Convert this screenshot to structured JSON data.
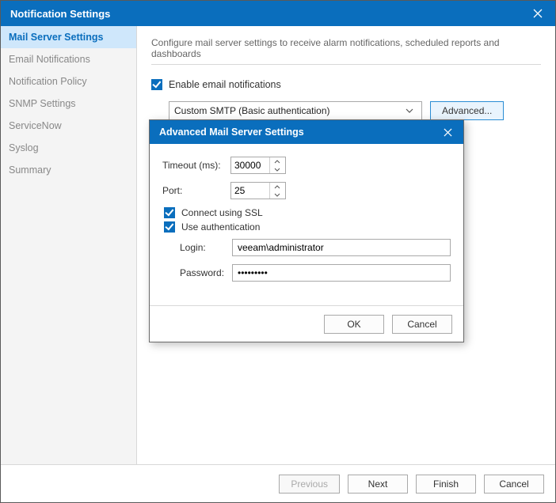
{
  "window": {
    "title": "Notification Settings"
  },
  "sidebar": {
    "items": [
      {
        "label": "Mail Server Settings",
        "selected": true
      },
      {
        "label": "Email Notifications"
      },
      {
        "label": "Notification Policy"
      },
      {
        "label": "SNMP Settings"
      },
      {
        "label": "ServiceNow"
      },
      {
        "label": "Syslog"
      },
      {
        "label": "Summary"
      }
    ]
  },
  "main": {
    "description": "Configure mail server settings to receive alarm notifications, scheduled reports and dashboards",
    "enable_label": "Enable email notifications",
    "enable_checked": true,
    "smtp_select": "Custom SMTP (Basic authentication)",
    "advanced_button": "Advanced..."
  },
  "footer": {
    "previous": "Previous",
    "next": "Next",
    "finish": "Finish",
    "cancel": "Cancel"
  },
  "modal": {
    "title": "Advanced Mail Server Settings",
    "timeout_label": "Timeout (ms):",
    "timeout_value": "30000",
    "port_label": "Port:",
    "port_value": "25",
    "ssl_label": "Connect using SSL",
    "ssl_checked": true,
    "auth_label": "Use authentication",
    "auth_checked": true,
    "login_label": "Login:",
    "login_value": "veeam\\administrator",
    "password_label": "Password:",
    "password_value": "•••••••••",
    "ok": "OK",
    "cancel": "Cancel"
  }
}
